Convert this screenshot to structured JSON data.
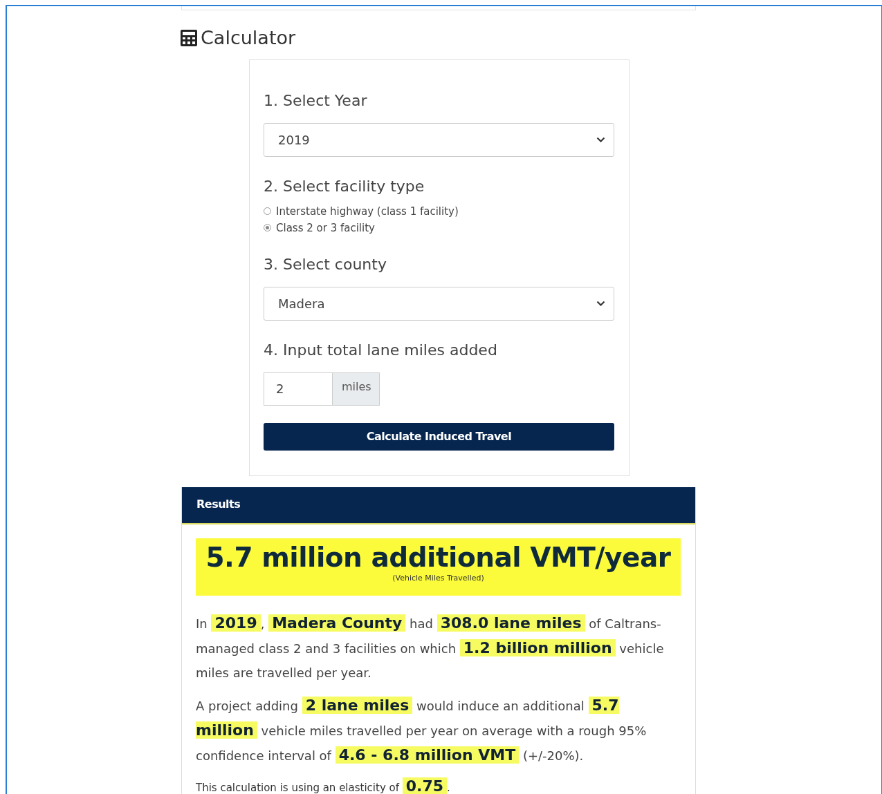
{
  "heading": "Calculator",
  "form": {
    "year": {
      "label": "1. Select Year",
      "value": "2019"
    },
    "facility": {
      "label": "2. Select facility type",
      "options": [
        {
          "label": "Interstate highway (class 1 facility)",
          "selected": false
        },
        {
          "label": "Class 2 or 3 facility",
          "selected": true
        }
      ]
    },
    "county": {
      "label": "3. Select county",
      "value": "Madera"
    },
    "miles": {
      "label": "4. Input total lane miles added",
      "value": "2",
      "unit": "miles"
    },
    "button": "Calculate Induced Travel"
  },
  "results": {
    "title": "Results",
    "headline": "5.7 million additional VMT/year",
    "subtitle": "(Vehicle Miles Travelled)",
    "paragraphs": [
      {
        "kind": "main",
        "text": "In **2019**, **Madera County** had **308.0 lane miles** of Caltrans-managed class 2 and 3 facilities on which **1.2 billion million** vehicle miles are travelled per year."
      },
      {
        "kind": "main",
        "text": "A project adding **2 lane miles** would induce an additional **5.7 million** vehicle miles travelled per year on average with a rough 95% confidence interval of **4.6 - 6.8 million VMT** (+/-20%)."
      },
      {
        "kind": "note",
        "text": "This calculation is using an elasticity of **0.75**."
      }
    ]
  }
}
